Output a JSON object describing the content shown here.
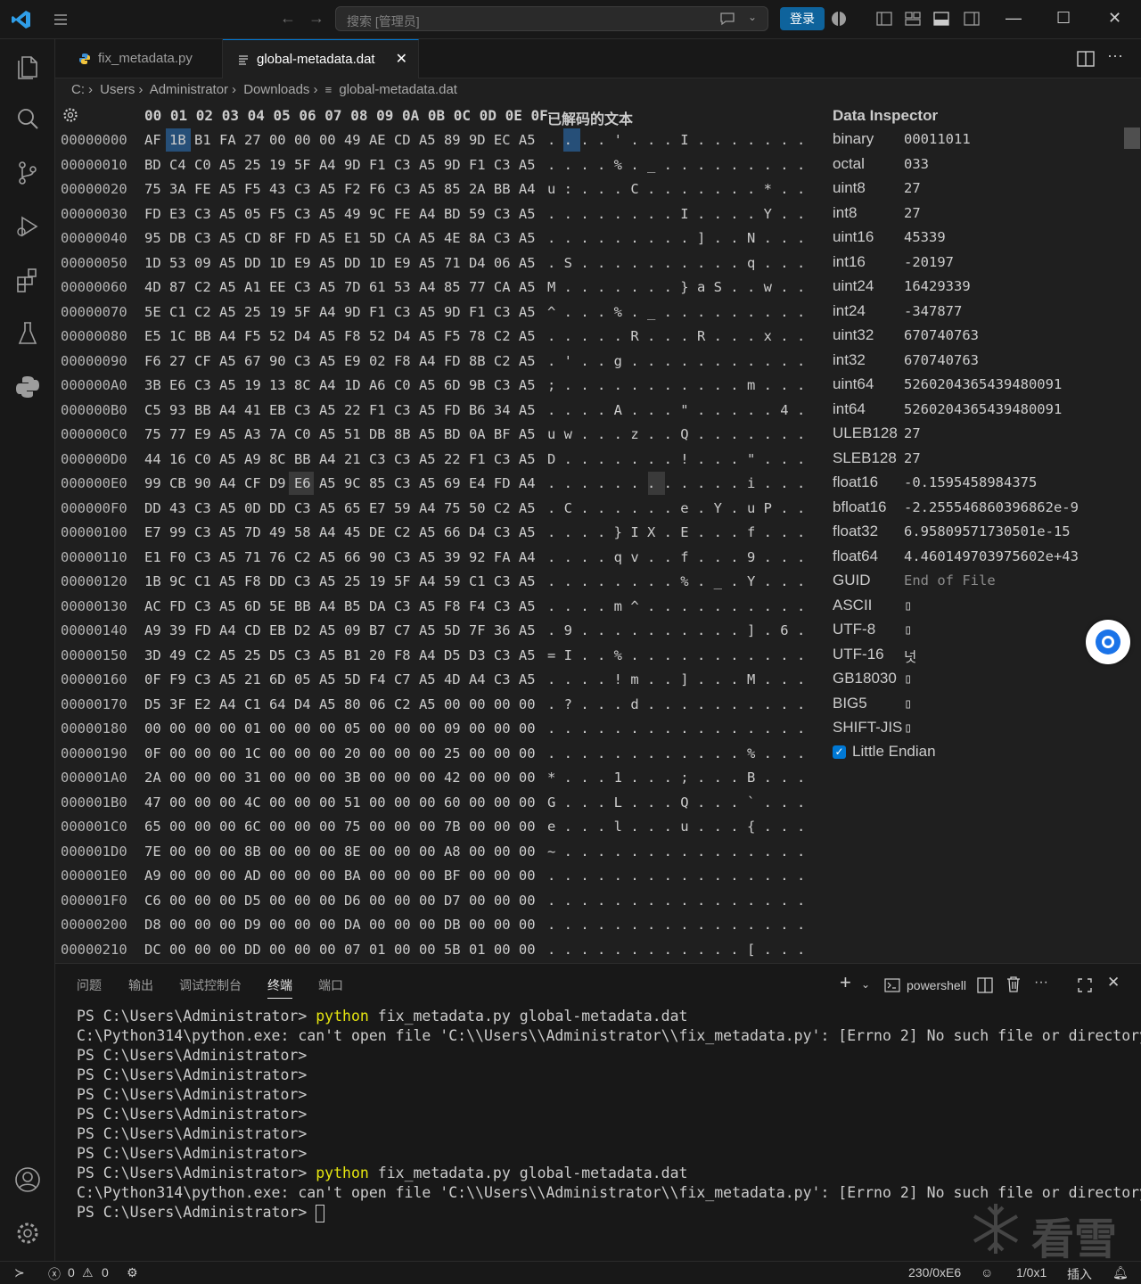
{
  "titlebar": {
    "search_placeholder": "搜索 [管理员]",
    "login_label": "登录"
  },
  "tabs": [
    {
      "label": "fix_metadata.py",
      "active": false
    },
    {
      "label": "global-metadata.dat",
      "active": true
    }
  ],
  "breadcrumb": [
    "C:",
    "Users",
    "Administrator",
    "Downloads",
    "global-metadata.dat"
  ],
  "hex": {
    "header_bytes": "00 01 02 03 04 05 06 07 08 09 0A 0B 0C 0D 0E 0F",
    "header_text": "已解码的文本",
    "selected_offset": "1B",
    "rows": [
      {
        "addr": "00000000",
        "bytes": "AF 1B B1 FA 27 00 00 00 49 AE CD A5 89 9D EC A5",
        "ascii": ". . . . ' . . . I . . . . . . ."
      },
      {
        "addr": "00000010",
        "bytes": "BD C4 C0 A5 25 19 5F A4 9D F1 C3 A5 9D F1 C3 A5",
        "ascii": ". . . . % . _ . . . . . . . . ."
      },
      {
        "addr": "00000020",
        "bytes": "75 3A FE A5 F5 43 C3 A5 F2 F6 C3 A5 85 2A BB A4",
        "ascii": "u : . . . C . . . . . . . * . ."
      },
      {
        "addr": "00000030",
        "bytes": "FD E3 C3 A5 05 F5 C3 A5 49 9C FE A4 BD 59 C3 A5",
        "ascii": ". . . . . . . . I . . . . Y . ."
      },
      {
        "addr": "00000040",
        "bytes": "95 DB C3 A5 CD 8F FD A5 E1 5D CA A5 4E 8A C3 A5",
        "ascii": ". . . . . . . . . ] . . N . . ."
      },
      {
        "addr": "00000050",
        "bytes": "1D 53 09 A5 DD 1D E9 A5 DD 1D E9 A5 71 D4 06 A5",
        "ascii": ". S . . . . . . . . . . q . . ."
      },
      {
        "addr": "00000060",
        "bytes": "4D 87 C2 A5 A1 EE C3 A5 7D 61 53 A4 85 77 CA A5",
        "ascii": "M . . . . . . . } a S . . w . ."
      },
      {
        "addr": "00000070",
        "bytes": "5E C1 C2 A5 25 19 5F A4 9D F1 C3 A5 9D F1 C3 A5",
        "ascii": "^ . . . % . _ . . . . . . . . ."
      },
      {
        "addr": "00000080",
        "bytes": "E5 1C BB A4 F5 52 D4 A5 F8 52 D4 A5 F5 78 C2 A5",
        "ascii": ". . . . . R . . . R . . . x . ."
      },
      {
        "addr": "00000090",
        "bytes": "F6 27 CF A5 67 90 C3 A5 E9 02 F8 A4 FD 8B C2 A5",
        "ascii": ". ' . . g . . . . . . . . . . ."
      },
      {
        "addr": "000000A0",
        "bytes": "3B E6 C3 A5 19 13 8C A4 1D A6 C0 A5 6D 9B C3 A5",
        "ascii": "; . . . . . . . . . . . m . . ."
      },
      {
        "addr": "000000B0",
        "bytes": "C5 93 BB A4 41 EB C3 A5 22 F1 C3 A5 FD B6 34 A5",
        "ascii": ". . . . A . . . \" . . . . . 4 ."
      },
      {
        "addr": "000000C0",
        "bytes": "75 77 E9 A5 A3 7A C0 A5 51 DB 8B A5 BD 0A BF A5",
        "ascii": "u w . . . z . . Q . . . . . . ."
      },
      {
        "addr": "000000D0",
        "bytes": "44 16 C0 A5 A9 8C BB A4 21 C3 C3 A5 22 F1 C3 A5",
        "ascii": "D . . . . . . . ! . . . \" . . ."
      },
      {
        "addr": "000000E0",
        "bytes": "99 CB 90 A4 CF D9 E6 A5 9C 85 C3 A5 69 E4 FD A4",
        "ascii": ". . . . . . . . . . . . i . . ."
      },
      {
        "addr": "000000F0",
        "bytes": "DD 43 C3 A5 0D DD C3 A5 65 E7 59 A4 75 50 C2 A5",
        "ascii": ". C . . . . . . e . Y . u P . ."
      },
      {
        "addr": "00000100",
        "bytes": "E7 99 C3 A5 7D 49 58 A4 45 DE C2 A5 66 D4 C3 A5",
        "ascii": ". . . . } I X . E . . . f . . ."
      },
      {
        "addr": "00000110",
        "bytes": "E1 F0 C3 A5 71 76 C2 A5 66 90 C3 A5 39 92 FA A4",
        "ascii": ". . . . q v . . f . . . 9 . . ."
      },
      {
        "addr": "00000120",
        "bytes": "1B 9C C1 A5 F8 DD C3 A5 25 19 5F A4 59 C1 C3 A5",
        "ascii": ". . . . . . . . % . _ . Y . . ."
      },
      {
        "addr": "00000130",
        "bytes": "AC FD C3 A5 6D 5E BB A4 B5 DA C3 A5 F8 F4 C3 A5",
        "ascii": ". . . . m ^ . . . . . . . . . ."
      },
      {
        "addr": "00000140",
        "bytes": "A9 39 FD A4 CD EB D2 A5 09 B7 C7 A5 5D 7F 36 A5",
        "ascii": ". 9 . . . . . . . . . . ] . 6 ."
      },
      {
        "addr": "00000150",
        "bytes": "3D 49 C2 A5 25 D5 C3 A5 B1 20 F8 A4 D5 D3 C3 A5",
        "ascii": "= I . . % . . . . . . . . . . ."
      },
      {
        "addr": "00000160",
        "bytes": "0F F9 C3 A5 21 6D 05 A5 5D F4 C7 A5 4D A4 C3 A5",
        "ascii": ". . . . ! m . . ] . . . M . . ."
      },
      {
        "addr": "00000170",
        "bytes": "D5 3F E2 A4 C1 64 D4 A5 80 06 C2 A5 00 00 00 00",
        "ascii": ". ? . . . d . . . . . . . . . ."
      },
      {
        "addr": "00000180",
        "bytes": "00 00 00 00 01 00 00 00 05 00 00 00 09 00 00 00",
        "ascii": ". . . . . . . . . . . . . . . ."
      },
      {
        "addr": "00000190",
        "bytes": "0F 00 00 00 1C 00 00 00 20 00 00 00 25 00 00 00",
        "ascii": ". . . . . . . . . . . . % . . ."
      },
      {
        "addr": "000001A0",
        "bytes": "2A 00 00 00 31 00 00 00 3B 00 00 00 42 00 00 00",
        "ascii": "* . . . 1 . . . ; . . . B . . ."
      },
      {
        "addr": "000001B0",
        "bytes": "47 00 00 00 4C 00 00 00 51 00 00 00 60 00 00 00",
        "ascii": "G . . . L . . . Q . . . ` . . ."
      },
      {
        "addr": "000001C0",
        "bytes": "65 00 00 00 6C 00 00 00 75 00 00 00 7B 00 00 00",
        "ascii": "e . . . l . . . u . . . { . . ."
      },
      {
        "addr": "000001D0",
        "bytes": "7E 00 00 00 8B 00 00 00 8E 00 00 00 A8 00 00 00",
        "ascii": "~ . . . . . . . . . . . . . . ."
      },
      {
        "addr": "000001E0",
        "bytes": "A9 00 00 00 AD 00 00 00 BA 00 00 00 BF 00 00 00",
        "ascii": ". . . . . . . . . . . . . . . ."
      },
      {
        "addr": "000001F0",
        "bytes": "C6 00 00 00 D5 00 00 00 D6 00 00 00 D7 00 00 00",
        "ascii": ". . . . . . . . . . . . . . . ."
      },
      {
        "addr": "00000200",
        "bytes": "D8 00 00 00 D9 00 00 00 DA 00 00 00 DB 00 00 00",
        "ascii": ". . . . . . . . . . . . . . . ."
      },
      {
        "addr": "00000210",
        "bytes": "DC 00 00 00 DD 00 00 00 07 01 00 00 5B 01 00 00",
        "ascii": ". . . . . . . . . . . . [ . . ."
      }
    ]
  },
  "inspector": {
    "title": "Data Inspector",
    "rows": [
      {
        "k": "binary",
        "v": "00011011"
      },
      {
        "k": "octal",
        "v": "033"
      },
      {
        "k": "uint8",
        "v": "27"
      },
      {
        "k": "int8",
        "v": "27"
      },
      {
        "k": "uint16",
        "v": "45339"
      },
      {
        "k": "int16",
        "v": "-20197"
      },
      {
        "k": "uint24",
        "v": "16429339"
      },
      {
        "k": "int24",
        "v": "-347877"
      },
      {
        "k": "uint32",
        "v": "670740763"
      },
      {
        "k": "int32",
        "v": "670740763"
      },
      {
        "k": "uint64",
        "v": "5260204365439480091"
      },
      {
        "k": "int64",
        "v": "5260204365439480091"
      },
      {
        "k": "ULEB128",
        "v": "27"
      },
      {
        "k": "SLEB128",
        "v": "27"
      },
      {
        "k": "float16",
        "v": "-0.1595458984375"
      },
      {
        "k": "bfloat16",
        "v": "-2.255546860396862e-9"
      },
      {
        "k": "float32",
        "v": "6.95809571730501e-15"
      },
      {
        "k": "float64",
        "v": "4.460149703975602e+43"
      },
      {
        "k": "GUID",
        "v": "End of File"
      },
      {
        "k": "ASCII",
        "v": "▯"
      },
      {
        "k": "UTF-8",
        "v": "▯"
      },
      {
        "k": "UTF-16",
        "v": "넛"
      },
      {
        "k": "GB18030",
        "v": "▯"
      },
      {
        "k": "BIG5",
        "v": "▯"
      },
      {
        "k": "SHIFT-JIS",
        "v": "▯"
      }
    ],
    "little_endian_label": "Little Endian",
    "little_endian": true
  },
  "panel": {
    "tabs": [
      "问题",
      "输出",
      "调试控制台",
      "终端",
      "端口"
    ],
    "active_tab": "终端",
    "shell_label": "powershell",
    "lines": [
      {
        "prompt": "PS C:\\Users\\Administrator> ",
        "cmd": "python",
        "rest": " fix_metadata.py global-metadata.dat"
      },
      {
        "prompt": "",
        "cmd": "",
        "rest": "C:\\Python314\\python.exe: can't open file 'C:\\\\Users\\\\Administrator\\\\fix_metadata.py': [Errno 2] No such file or directory"
      },
      {
        "prompt": "PS C:\\Users\\Administrator>",
        "cmd": "",
        "rest": ""
      },
      {
        "prompt": "PS C:\\Users\\Administrator>",
        "cmd": "",
        "rest": ""
      },
      {
        "prompt": "PS C:\\Users\\Administrator>",
        "cmd": "",
        "rest": ""
      },
      {
        "prompt": "PS C:\\Users\\Administrator>",
        "cmd": "",
        "rest": ""
      },
      {
        "prompt": "PS C:\\Users\\Administrator>",
        "cmd": "",
        "rest": ""
      },
      {
        "prompt": "PS C:\\Users\\Administrator>",
        "cmd": "",
        "rest": ""
      },
      {
        "prompt": "PS C:\\Users\\Administrator> ",
        "cmd": "python",
        "rest": " fix_metadata.py global-metadata.dat"
      },
      {
        "prompt": "",
        "cmd": "",
        "rest": "C:\\Python314\\python.exe: can't open file 'C:\\\\Users\\\\Administrator\\\\fix_metadata.py': [Errno 2] No such file or directory"
      },
      {
        "prompt": "PS C:\\Users\\Administrator> ",
        "cmd": "",
        "rest": "",
        "cursor": true
      }
    ]
  },
  "watermark": "看雪",
  "statusbar": {
    "errors": "0",
    "warnings": "0",
    "offset": "230/0xE6",
    "selection": "1/0x1",
    "mode": "插入"
  },
  "colors": {
    "accent": "#0078d4",
    "selection": "#264f78",
    "cmd_yellow": "#e5e510"
  }
}
